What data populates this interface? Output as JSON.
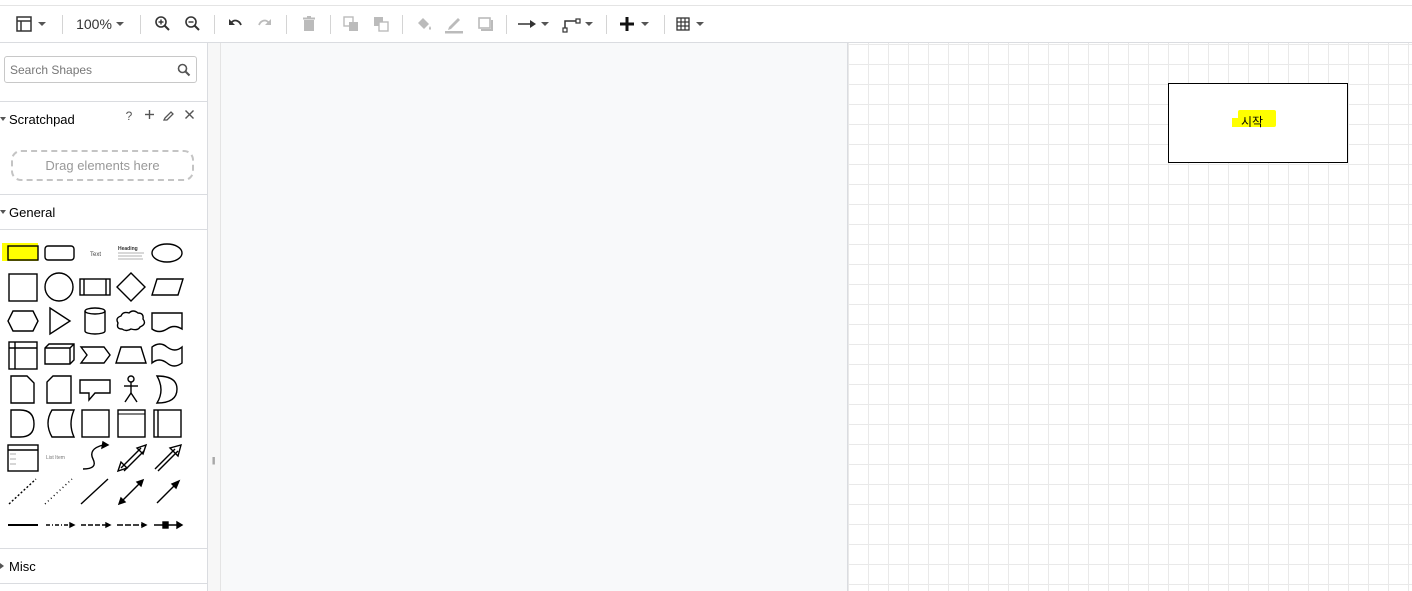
{
  "toolbar": {
    "zoom_label": "100%",
    "items": [
      "format-panel",
      "zoom",
      "zoom-in",
      "zoom-out",
      "undo",
      "redo",
      "delete",
      "to-front",
      "to-back",
      "fill-color",
      "line-color",
      "shadow",
      "connection",
      "waypoints",
      "insert",
      "table"
    ]
  },
  "sidebar": {
    "search": {
      "placeholder": "Search Shapes",
      "value": ""
    },
    "scratchpad": {
      "title": "Scratchpad",
      "help": "?",
      "drag_hint": "Drag elements here"
    },
    "general": {
      "title": "General",
      "text_shape": "Text",
      "heading_shape": "Heading",
      "list_shape": "List Item"
    },
    "misc": {
      "title": "Misc"
    }
  },
  "canvas": {
    "node": {
      "label": "시작",
      "highlight_color": "#ffff00"
    }
  },
  "colors": {
    "highlight": "#ffff00",
    "grid": "#e9e9e9",
    "border": "#dadce0"
  }
}
